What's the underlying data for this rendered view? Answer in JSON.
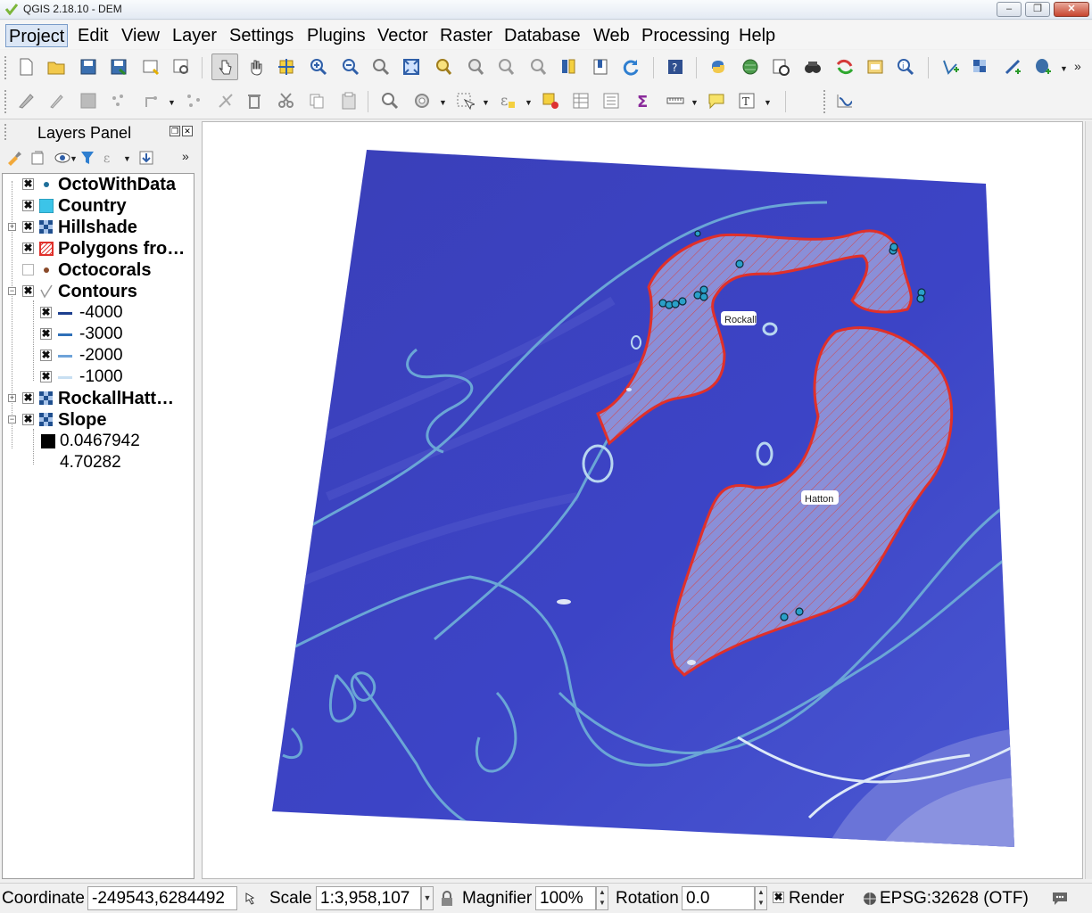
{
  "window": {
    "title": "QGIS 2.18.10 - DEM",
    "minimize": "–",
    "maximize": "❐",
    "close": "✕"
  },
  "menu": [
    "Project",
    "Edit",
    "View",
    "Layer",
    "Settings",
    "Plugins",
    "Vector",
    "Raster",
    "Database",
    "Web",
    "Processing",
    "Help"
  ],
  "layers_panel": {
    "title": "Layers Panel",
    "layers": [
      {
        "name": "OctoWithData",
        "checked": "✖",
        "symbol": "point-dot"
      },
      {
        "name": "Country",
        "checked": "✖",
        "symbol": "cyan-fill"
      },
      {
        "name": "Hillshade",
        "checked": "✖",
        "symbol": "raster-grid",
        "expand": "+"
      },
      {
        "name": "Polygons fro…",
        "checked": "✖",
        "symbol": "red-hatched"
      },
      {
        "name": "Octocorals",
        "checked": "",
        "symbol": "brown-dot"
      },
      {
        "name": "Contours",
        "checked": "✖",
        "symbol": "line",
        "expand": "−"
      },
      {
        "name": "RockallHatt…",
        "checked": "✖",
        "symbol": "raster-grid",
        "expand": "+"
      },
      {
        "name": "Slope",
        "checked": "✖",
        "symbol": "raster-grid",
        "expand": "−"
      }
    ],
    "contour_classes": [
      {
        "label": "-4000",
        "color": "#1d3f8f",
        "checked": "✖"
      },
      {
        "label": "-3000",
        "color": "#2f6fb8",
        "checked": "✖"
      },
      {
        "label": "-2000",
        "color": "#6ea3d9",
        "checked": "✖"
      },
      {
        "label": "-1000",
        "color": "#c8dff2",
        "checked": "✖"
      }
    ],
    "slope_legend": {
      "min": "0.0467942",
      "max": "4.70282"
    }
  },
  "map": {
    "labels": {
      "rockall": "Rockall",
      "hatton": "Hatton"
    },
    "colors": {
      "background": "#3a3fc0",
      "polygon_outline": "#e0302a",
      "contour": "#6aa6d6",
      "points": "#2aa0c8"
    }
  },
  "statusbar": {
    "coordinate_label": "Coordinate",
    "coordinate_value": "-249543,6284492",
    "scale_label": "Scale",
    "scale_value": "1:3,958,107",
    "magnifier_label": "Magnifier",
    "magnifier_value": "100%",
    "rotation_label": "Rotation",
    "rotation_value": "0.0",
    "render_label": "Render",
    "render_checked": "✖",
    "crs": "EPSG:32628 (OTF)"
  }
}
